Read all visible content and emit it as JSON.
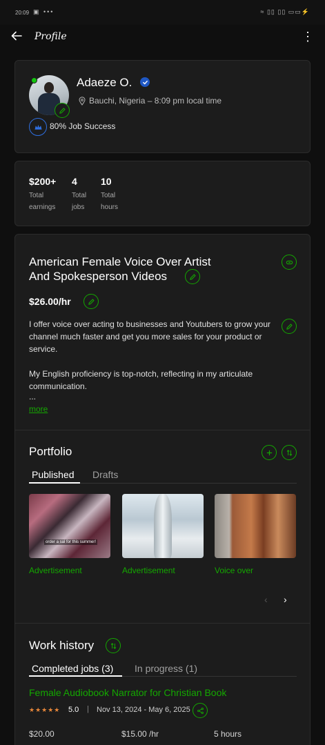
{
  "status_bar": {
    "time": "20:09",
    "left_icons": "▣ •••",
    "right_icons": "≈ ▯▯ ▯▯ ▭▭⚡"
  },
  "app_bar": {
    "title": "Profile"
  },
  "profile": {
    "name": "Adaeze O.",
    "location": "Bauchi, Nigeria – 8:09 pm local time",
    "job_success": "80% Job Success"
  },
  "stats": [
    {
      "value": "$200+",
      "label_line1": "Total",
      "label_line2": "earnings"
    },
    {
      "value": "4",
      "label_line1": "Total",
      "label_line2": "jobs"
    },
    {
      "value": "10",
      "label_line1": "Total",
      "label_line2": "hours"
    }
  ],
  "headline": {
    "title_line1": "American Female Voice Over Artist",
    "title_line2": "And Spokesperson Videos",
    "rate": "$26.00/hr",
    "desc_p1": "I offer voice over acting to businesses and Youtubers to grow your channel much faster and get you more sales for your product or service.",
    "desc_p2": "My English proficiency is top-notch, reflecting in my articulate communication.",
    "ellipsis": "...",
    "more_label": "more"
  },
  "portfolio": {
    "title": "Portfolio",
    "tabs": [
      "Published",
      "Drafts"
    ],
    "items": [
      {
        "label": "Advertisement",
        "overlay_text": "order a sal for this summer!"
      },
      {
        "label": "Advertisement"
      },
      {
        "label": "Voice over"
      }
    ]
  },
  "work_history": {
    "title": "Work history",
    "tabs": [
      "Completed jobs (3)",
      "In progress (1)"
    ],
    "job": {
      "title": "Female Audiobook Narrator for Christian Book",
      "stars": "★★★★★",
      "rating": "5.0",
      "separator": "|",
      "dates": "Nov 13, 2024 - May 6, 2025",
      "earned": "$20.00",
      "rate": "$15.00 /hr",
      "hours": "5 hours"
    }
  },
  "colors": {
    "accent_green": "#14a800",
    "background": "#0f0f0f",
    "card": "#1c1c1c",
    "verified_blue": "#1f57c3",
    "star_orange": "#e8873a"
  }
}
